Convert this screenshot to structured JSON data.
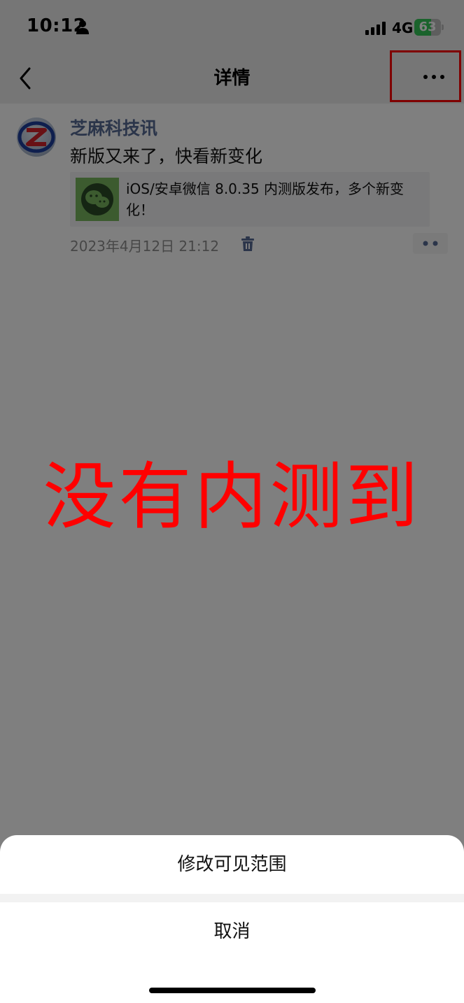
{
  "status_bar": {
    "time": "10:12",
    "network": "4G",
    "battery_percent": "63",
    "battery_level": 0.63,
    "battery_color": "#34c759"
  },
  "nav": {
    "title": "详情",
    "back_icon": "chevron-left-icon",
    "more_icon": "more-dots-icon",
    "highlight_color": "#ff0000"
  },
  "post": {
    "author": "芝麻科技讯",
    "author_color": "#576b95",
    "text": "新版又来了，快看新变化",
    "link": {
      "title": "iOS/安卓微信 8.0.35 内测版发布，多个新变化！",
      "thumb_icon": "wechat-logo-icon"
    },
    "timestamp": "2023年4月12日 21:12",
    "delete_icon": "trash-icon",
    "comment_icon": "comment-dots-icon"
  },
  "annotation": {
    "text": "没有内测到",
    "color": "#ff0000"
  },
  "action_sheet": {
    "option": "修改可见范围",
    "cancel": "取消"
  }
}
